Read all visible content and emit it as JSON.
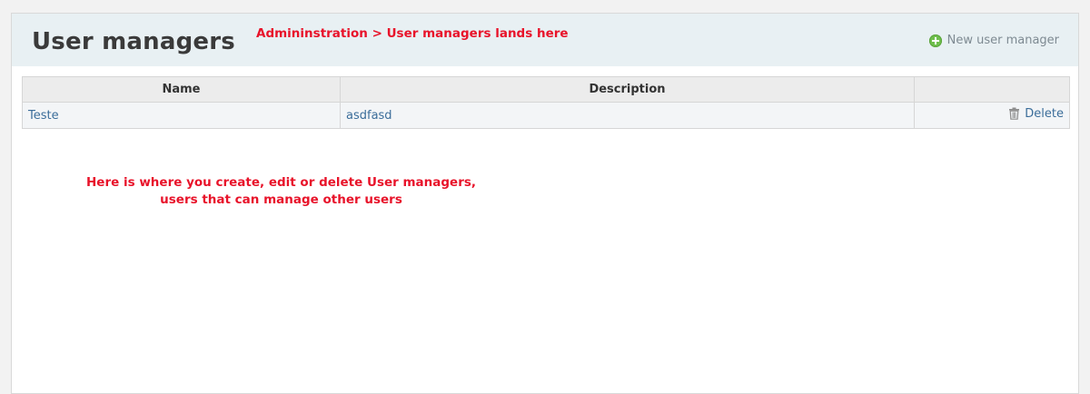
{
  "header": {
    "title": "User managers",
    "annotation": "Admininstration > User managers lands here",
    "new_button_label": "New user manager",
    "new_button_icon": "plus-circle-icon"
  },
  "table": {
    "columns": [
      "Name",
      "Description",
      ""
    ],
    "rows": [
      {
        "name": "Teste",
        "description": "asdfasd",
        "action_label": "Delete",
        "action_icon": "trash-icon"
      }
    ]
  },
  "annotations": {
    "line1": "Here is where you create, edit or delete User managers,",
    "line2": "users that can manage other users"
  },
  "colors": {
    "annotation": "#e8132a",
    "link": "#3b6d9a",
    "header_bg": "#e8f0f3",
    "add_icon": "#6fbf4d"
  }
}
